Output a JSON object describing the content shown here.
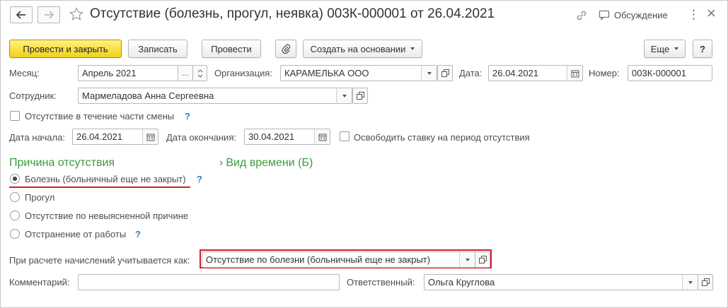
{
  "header": {
    "title": "Отсутствие (болезнь, прогул, неявка) 003К-000001 от 26.04.2021",
    "discussion_label": "Обсуждение",
    "more_dots": "⋮",
    "close_glyph": "×"
  },
  "toolbar": {
    "post_close_label": "Провести и закрыть",
    "save_label": "Записать",
    "post_label": "Провести",
    "create_based_label": "Создать на основании",
    "more_label": "Еще",
    "help_label": "?"
  },
  "fields": {
    "month_label": "Месяц:",
    "month_value": "Апрель 2021",
    "month_ellipsis": "...",
    "organization_label": "Организация:",
    "organization_value": "КАРАМЕЛЬКА ООО",
    "date_label": "Дата:",
    "date_value": "26.04.2021",
    "number_label": "Номер:",
    "number_value": "003К-000001",
    "employee_label": "Сотрудник:",
    "employee_value": "Мармеладова Анна Сергеевна",
    "partial_shift_label": "Отсутствие в течение части смены",
    "partial_shift_checked": false,
    "start_label": "Дата начала:",
    "start_value": "26.04.2021",
    "end_label": "Дата окончания:",
    "end_value": "30.04.2021",
    "free_rate_label": "Освободить ставку на период отсутствия",
    "free_rate_checked": false,
    "calc_label": "При расчете начислений учитывается как:",
    "calc_value": "Отсутствие по болезни (больничный еще не закрыт)",
    "comment_label": "Комментарий:",
    "comment_value": "",
    "responsible_label": "Ответственный:",
    "responsible_value": "Ольга Круглова"
  },
  "reason": {
    "heading": "Причина отсутствия",
    "time_type_label": "Вид времени (Б)",
    "options": [
      {
        "label": "Болезнь (больничный еще не закрыт)",
        "selected": true
      },
      {
        "label": "Прогул",
        "selected": false
      },
      {
        "label": "Отсутствие по невыясненной причине",
        "selected": false
      },
      {
        "label": "Отстранение от работы",
        "selected": false
      }
    ]
  },
  "help_marker": "?",
  "colors": {
    "accent_green": "#3c9a3c",
    "highlight_red": "#d0202a",
    "primary_button": "#f1d21a",
    "help_blue": "#2e7fb5"
  }
}
